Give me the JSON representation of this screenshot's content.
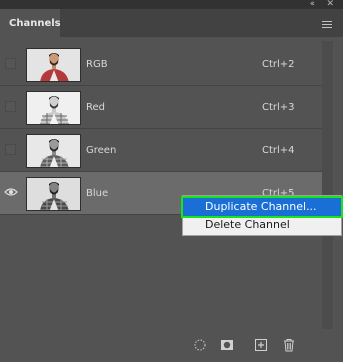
{
  "panel": {
    "tab_label": "Channels",
    "collapse_glyph": "‹‹",
    "close_glyph": "✕"
  },
  "channels": [
    {
      "name": "RGB",
      "shortcut": "Ctrl+2",
      "visible": false,
      "selected": false
    },
    {
      "name": "Red",
      "shortcut": "Ctrl+3",
      "visible": false,
      "selected": false
    },
    {
      "name": "Green",
      "shortcut": "Ctrl+4",
      "visible": false,
      "selected": false
    },
    {
      "name": "Blue",
      "shortcut": "Ctrl+5",
      "visible": true,
      "selected": true
    }
  ],
  "context_menu": {
    "items": [
      {
        "label": "Duplicate Channel...",
        "highlighted": true
      },
      {
        "label": "Delete Channel",
        "highlighted": false
      }
    ]
  },
  "colors": {
    "panel_bg": "#535353",
    "selected_row": "#6b6b6b",
    "menu_highlight": "#1a6fd6",
    "menu_outline": "#18e418"
  },
  "bottom_bar": {
    "icons": [
      "load-selection-icon",
      "save-selection-icon",
      "new-channel-icon",
      "delete-channel-icon"
    ]
  }
}
